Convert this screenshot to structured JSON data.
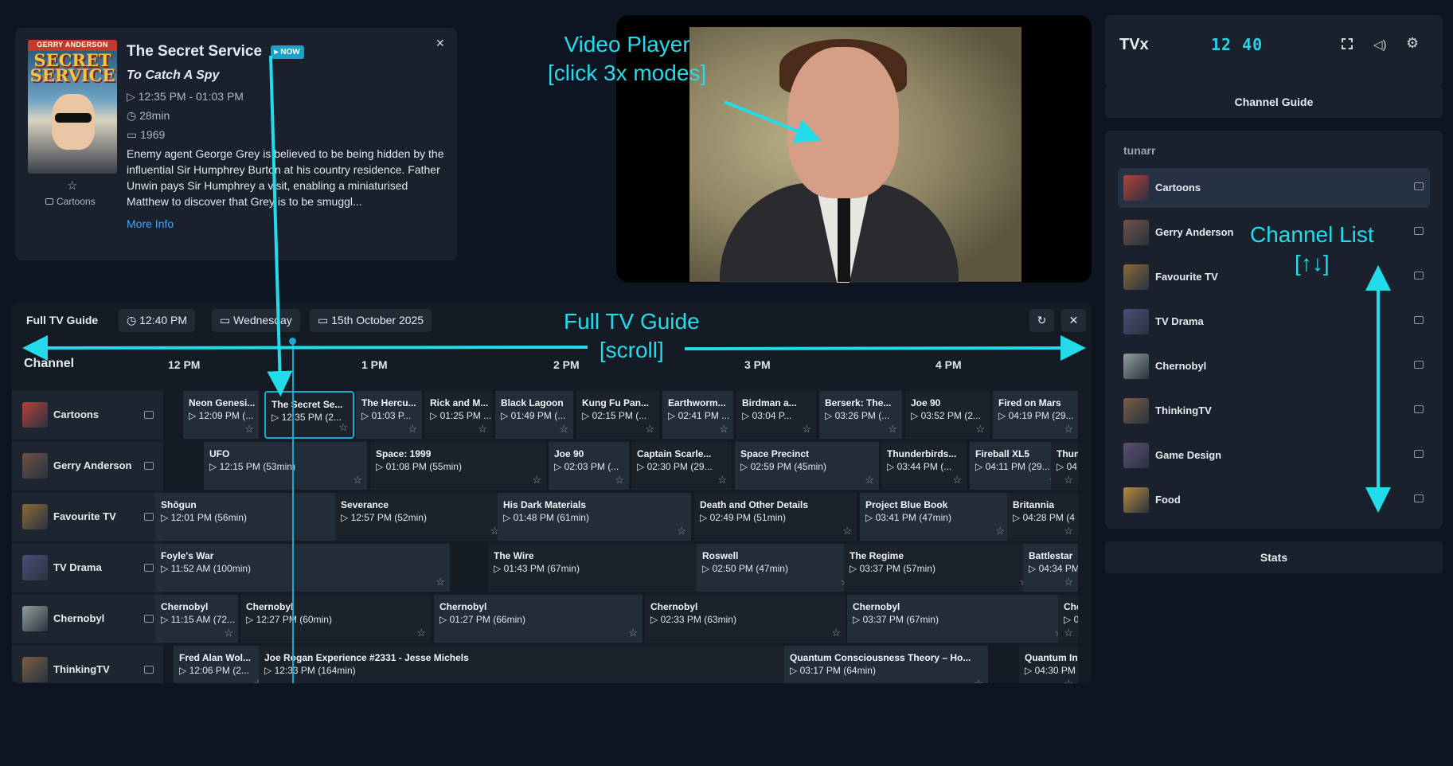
{
  "info_card": {
    "poster_brand": "GERRY ANDERSON",
    "poster_title": "SECRET SERVICE",
    "title": "The Secret Service",
    "badge": "▸ NOW",
    "episode": "To Catch A Spy",
    "time": "▷ 12:35 PM - 01:03 PM",
    "duration": "◷ 28min",
    "year": "▭ 1969",
    "description": "Enemy agent George Grey is believed to be being hidden by the influential Sir Humphrey Burton at his country residence. Father Unwin pays Sir Humphrey a visit, enabling a miniaturised Matthew to discover that Grey is to be smuggl...",
    "more_info": "More Info",
    "channel": "Cartoons",
    "star": "☆",
    "close": "✕"
  },
  "topbar": {
    "app_name": "TVx",
    "clock": "12 40"
  },
  "channel_guide_button": "Channel Guide",
  "stats_button": "Stats",
  "channel_list": {
    "header": "tunarr",
    "items": [
      {
        "name": "Cartoons",
        "selected": true,
        "color": "#b5413a"
      },
      {
        "name": "Gerry Anderson",
        "color": "#6f5244"
      },
      {
        "name": "Favourite TV",
        "color": "#8a6a36"
      },
      {
        "name": "TV Drama",
        "color": "#4a4e78"
      },
      {
        "name": "Chernobyl",
        "color": "#8fa09a"
      },
      {
        "name": "ThinkingTV",
        "color": "#7a5d45"
      },
      {
        "name": "Game Design",
        "color": "#5b4f74"
      },
      {
        "name": "Food",
        "color": "#b88a3a"
      }
    ]
  },
  "guide": {
    "label": "Full TV Guide",
    "time": "◷ 12:40 PM",
    "day": "▭ Wednesday",
    "date": "▭ 15th October 2025",
    "channel_header": "Channel",
    "hours": [
      "12 PM",
      "1 PM",
      "2 PM",
      "3 PM",
      "4 PM"
    ],
    "rows": [
      {
        "channel": "Cartoons",
        "color": "#b5413a",
        "programs": [
          {
            "t": "Neon Genesi...",
            "s": "▷ 12:09 PM (..."
          },
          {
            "t": "The Secret Se...",
            "s": "▷ 12:35 PM (2...",
            "sel": true
          },
          {
            "t": "The Hercu...",
            "s": "▷ 01:03 P..."
          },
          {
            "t": "Rick and M...",
            "s": "▷ 01:25 PM ..."
          },
          {
            "t": "Black Lagoon",
            "s": "▷ 01:49 PM (..."
          },
          {
            "t": "Kung Fu Pan...",
            "s": "▷ 02:15 PM (..."
          },
          {
            "t": "Earthworm...",
            "s": "▷ 02:41 PM ..."
          },
          {
            "t": "Birdman a...",
            "s": "▷ 03:04 P..."
          },
          {
            "t": "Berserk: The...",
            "s": "▷ 03:26 PM (..."
          },
          {
            "t": "Joe 90",
            "s": "▷ 03:52 PM (2..."
          },
          {
            "t": "Fired on Mars",
            "s": "▷ 04:19 PM (29..."
          }
        ]
      },
      {
        "channel": "Gerry Anderson",
        "color": "#6f5244",
        "programs": [
          {
            "t": "UFO",
            "s": "▷ 12:15 PM (53min)"
          },
          {
            "t": "Space: 1999",
            "s": "▷ 01:08 PM (55min)"
          },
          {
            "t": "Joe 90",
            "s": "▷ 02:03 PM (..."
          },
          {
            "t": "Captain Scarle...",
            "s": "▷ 02:30 PM (29..."
          },
          {
            "t": "Space Precinct",
            "s": "▷ 02:59 PM (45min)"
          },
          {
            "t": "Thunderbirds...",
            "s": "▷ 03:44 PM (..."
          },
          {
            "t": "Fireball XL5",
            "s": "▷ 04:11 PM (29..."
          },
          {
            "t": "Thund",
            "s": "▷ 04:"
          }
        ]
      },
      {
        "channel": "Favourite TV",
        "color": "#8a6a36",
        "programs": [
          {
            "t": "Shōgun",
            "s": "▷ 12:01 PM (56min)"
          },
          {
            "t": "Severance",
            "s": "▷ 12:57 PM (52min)"
          },
          {
            "t": "His Dark Materials",
            "s": "▷ 01:48 PM (61min)"
          },
          {
            "t": "Death and Other Details",
            "s": "▷ 02:49 PM (51min)"
          },
          {
            "t": "Project Blue Book",
            "s": "▷ 03:41 PM (47min)"
          },
          {
            "t": "Britannia",
            "s": "▷ 04:28 PM (4"
          }
        ]
      },
      {
        "channel": "TV Drama",
        "color": "#4a4e78",
        "programs": [
          {
            "t": "Foyle's War",
            "s": "▷ 11:52 AM (100min)"
          },
          {
            "t": "The Wire",
            "s": "▷ 01:43 PM (67min)"
          },
          {
            "t": "Roswell",
            "s": "▷ 02:50 PM (47min)"
          },
          {
            "t": "The Regime",
            "s": "▷ 03:37 PM (57min)"
          },
          {
            "t": "Battlestar",
            "s": "▷ 04:34 PM"
          }
        ]
      },
      {
        "channel": "Chernobyl",
        "color": "#8fa09a",
        "programs": [
          {
            "t": "Chernobyl",
            "s": "▷ 11:15 AM (72..."
          },
          {
            "t": "Chernobyl",
            "s": "▷ 12:27 PM (60min)"
          },
          {
            "t": "Chernobyl",
            "s": "▷ 01:27 PM (66min)"
          },
          {
            "t": "Chernobyl",
            "s": "▷ 02:33 PM (63min)"
          },
          {
            "t": "Chernobyl",
            "s": "▷ 03:37 PM (67min)"
          },
          {
            "t": "Che",
            "s": "▷ 0"
          }
        ]
      },
      {
        "channel": "ThinkingTV",
        "color": "#7a5d45",
        "programs": [
          {
            "t": "Fred Alan Wol...",
            "s": "▷ 12:06 PM (2..."
          },
          {
            "t": "Joe Rogan Experience #2331 - Jesse Michels",
            "s": "▷ 12:33 PM (164min)"
          },
          {
            "t": "Quantum Consciousness Theory – Ho...",
            "s": "▷ 03:17 PM (64min)"
          },
          {
            "t": "Quantum Inf",
            "s": "▷ 04:30 PM"
          }
        ]
      }
    ]
  },
  "annotations": {
    "video": "Video Player\n[click 3x modes]",
    "guide": "Full TV Guide\n[scroll]",
    "list": "Channel List\n[↑↓]"
  },
  "colors": {
    "accent": "#1aa9d1",
    "annotation": "#23dceb"
  }
}
